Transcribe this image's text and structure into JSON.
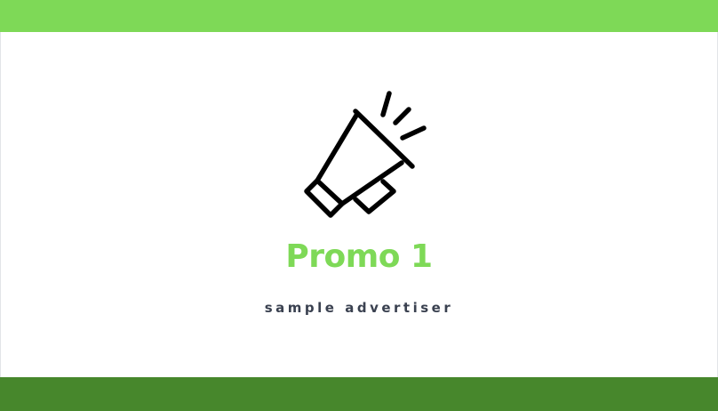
{
  "promo": {
    "title": "Promo 1",
    "subtitle": "sample advertiser",
    "icon": "megaphone-icon"
  },
  "colors": {
    "accent_light": "#7ED957",
    "accent_dark": "#47872C",
    "title": "#7ED957",
    "subtitle": "#3a4150"
  }
}
